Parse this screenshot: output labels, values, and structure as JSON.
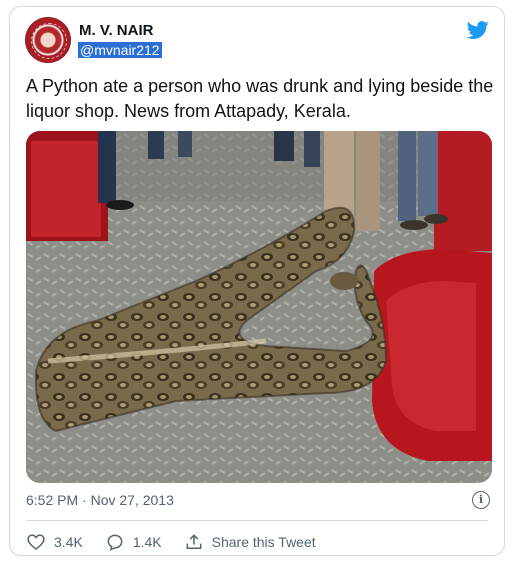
{
  "tweet": {
    "author_name": "M. V. NAIR",
    "author_handle": "@mvnair212",
    "text": "A Python ate a person who was drunk and lying beside the liquor shop. News from Attapady, Kerala.",
    "timestamp": "6:52 PM · Nov 27, 2013",
    "likes": "3.4K",
    "replies": "1.4K",
    "share_label": "Share this Tweet"
  },
  "icons": {
    "brand": "twitter-bird-icon",
    "like": "heart-icon",
    "reply": "speech-bubble-icon",
    "share": "share-icon",
    "info": "info-icon"
  },
  "colors": {
    "twitter_blue": "#1d9bf0",
    "text_secondary": "#536471",
    "handle_highlight": "#2b6fd6"
  }
}
